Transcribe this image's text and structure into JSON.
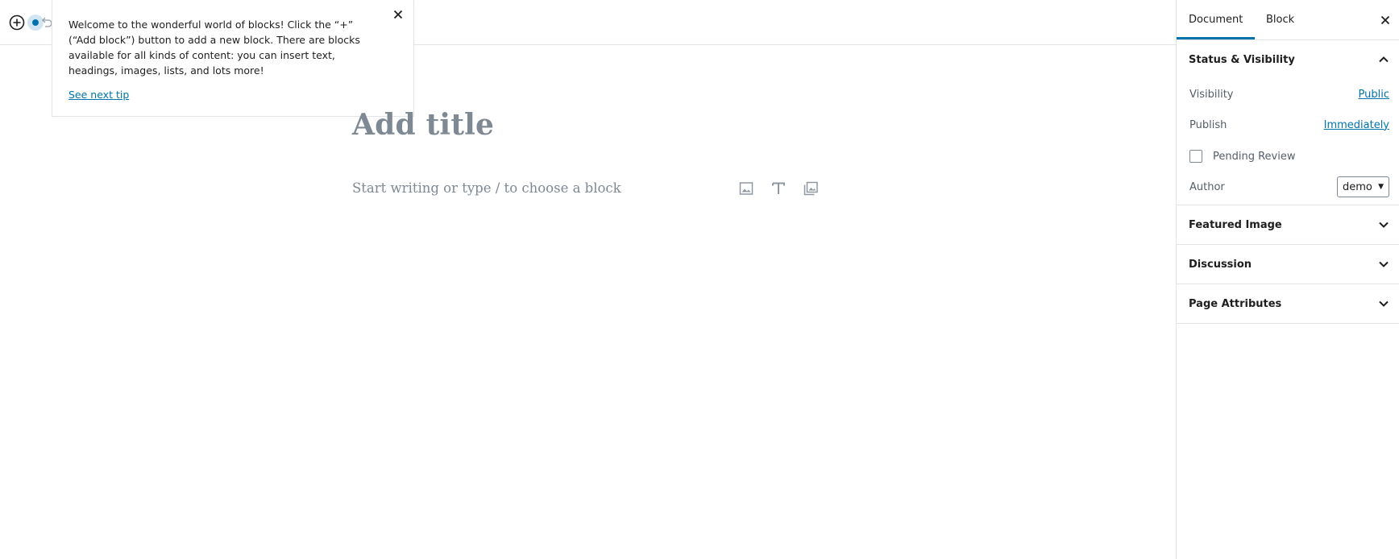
{
  "toolbar": {
    "add_block_icon": "plus-circle-icon",
    "undo_icon": "undo-icon"
  },
  "tip": {
    "text": "Welcome to the wonderful world of blocks! Click the “+” (“Add block”) button to add a new block. There are blocks available for all kinds of content: you can insert text, headings, images, lists, and lots more!",
    "link": "See next tip"
  },
  "editor": {
    "title_placeholder": "Add title",
    "block_placeholder": "Start writing or type / to choose a block",
    "inserter_icons": [
      "image-icon",
      "heading-icon",
      "gallery-icon"
    ]
  },
  "sidebar": {
    "tabs": [
      {
        "label": "Document",
        "active": true
      },
      {
        "label": "Block",
        "active": false
      }
    ],
    "panels": {
      "status": {
        "title": "Status & Visibility",
        "expanded": true,
        "visibility_label": "Visibility",
        "visibility_value": "Public",
        "publish_label": "Publish",
        "publish_value": "Immediately",
        "pending_review_label": "Pending Review",
        "author_label": "Author",
        "author_value": "demo"
      },
      "featured_image": {
        "title": "Featured Image",
        "expanded": false
      },
      "discussion": {
        "title": "Discussion",
        "expanded": false
      },
      "page_attributes": {
        "title": "Page Attributes",
        "expanded": false
      }
    }
  },
  "colors": {
    "accent": "#0073aa",
    "border": "#e2e4e7",
    "placeholder": "#7e8993"
  }
}
